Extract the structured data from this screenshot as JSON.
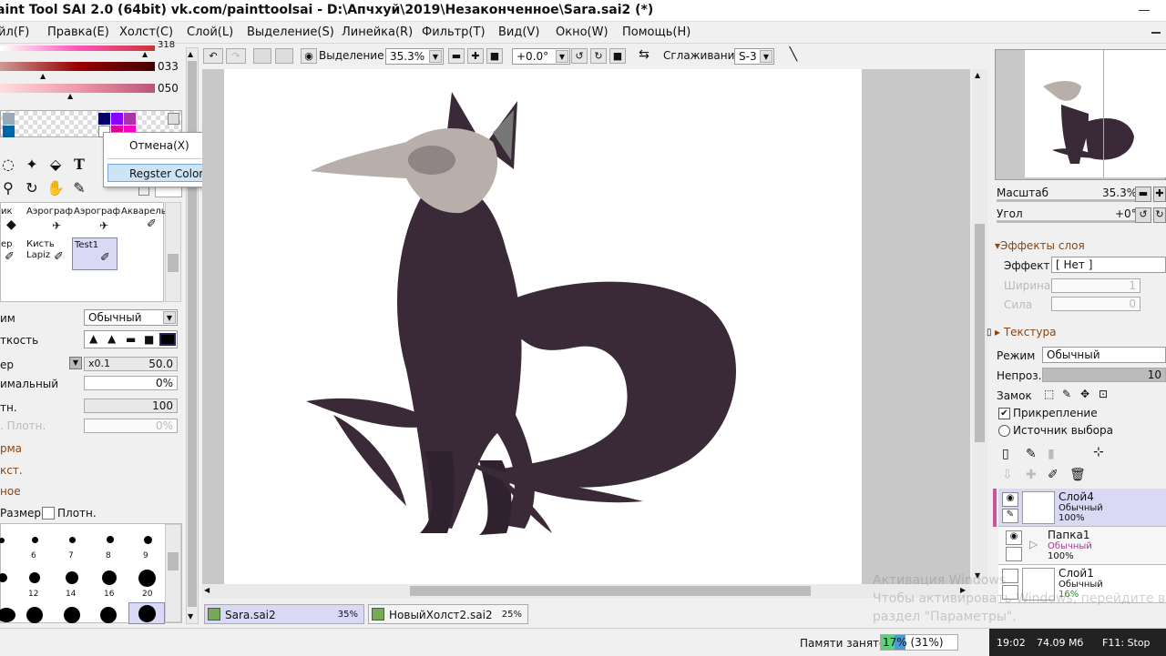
{
  "window": {
    "title": "aint Tool SAI 2.0 (64bit) vk.com/painttoolsai - D:\\Апчхуй\\2019\\Незаконченное\\Sara.sai2 (*)"
  },
  "menu": {
    "items": [
      "йл(F)",
      "Правка(E)",
      "Холст(C)",
      "Слой(L)",
      "Выделение(S)",
      "Линейка(R)",
      "Фильтр(T)",
      "Вид(V)",
      "Окно(W)",
      "Помощь(H)"
    ]
  },
  "color_sliders": {
    "top_partial": "318",
    "values": [
      "033",
      "050"
    ]
  },
  "context_menu": {
    "cancel": "Отмена(X)",
    "register": "Regster Color"
  },
  "brushes": {
    "row1": [
      "ик",
      "Аэрограф",
      "Аэрограф",
      "Акварель"
    ],
    "row2": [
      "ер",
      "Кисть\nLapiz",
      "Test1"
    ],
    "row2_kist": "Кисть",
    "row2_lapiz": "Lapiz"
  },
  "tool_props": {
    "mode_label": "им",
    "mode_value": "Обычный",
    "hardness_label": "ткость",
    "size_label": "ер",
    "size_mult": "x0.1",
    "size_value": "50.0",
    "min_label": "имальный",
    "min_value": "0%",
    "density_label": "тн.",
    "density_value": "100",
    "min_density_label": ". Плотн.",
    "min_density_value": "0%",
    "shape_label": "рма",
    "texture_label": "кст.",
    "extra_label": "ное",
    "size_check": "Размер",
    "density_check": "Плотн."
  },
  "brush_sizes": [
    "6",
    "7",
    "8",
    "9",
    "12",
    "14",
    "16",
    "20"
  ],
  "toolbar": {
    "selection_label": "Выделение",
    "zoom": "35.3%",
    "angle": "+0.0°",
    "smoothing_label": "Сглаживание",
    "smoothing_value": "S-3"
  },
  "doc_tabs": [
    {
      "name": "Sara.sai2",
      "pct": "35%"
    },
    {
      "name": "НовыйХолст2.sai2",
      "pct": "25%"
    }
  ],
  "navigator": {
    "zoom_label": "Масштаб",
    "zoom_value": "35.3%",
    "angle_label": "Угол",
    "angle_value": "+0°"
  },
  "layer_props": {
    "effects_header": "Эффекты слоя",
    "effect_label": "Эффект",
    "effect_value": "[ Нет ]",
    "width_label": "Ширина",
    "width_value": "1",
    "strength_label": "Сила",
    "strength_value": "0",
    "texture_header": "Текстура",
    "mode_label": "Режим",
    "mode_value": "Обычный",
    "opacity_label": "Непроз.",
    "opacity_value": "10",
    "lock_label": "Замок",
    "clipping": "Прикрепление",
    "source": "Источник выбора"
  },
  "layers": [
    {
      "name": "Слой4",
      "mode": "Обычный",
      "pct": "100%"
    },
    {
      "name": "Папка1",
      "mode": "Обычный",
      "pct": "100%"
    },
    {
      "name": "Слой1",
      "mode": "Обычный",
      "pct": "16%"
    }
  ],
  "status": {
    "memory_label": "Памяти занято",
    "memory_value": "17% (31%)",
    "time": "19:02",
    "memsize": "74.09 Мб",
    "stop": "F11: Stop"
  },
  "watermark": {
    "line1": "Активация Windows",
    "line2": "Чтобы активировать Windows, перейдите в",
    "line3": "раздел \"Параметры\"."
  },
  "colors": {
    "accent_selection": "#cde4f7",
    "fox_body": "#3a2a38",
    "skull": "#b8aeaa",
    "memory_bar": "#5ad17a"
  }
}
